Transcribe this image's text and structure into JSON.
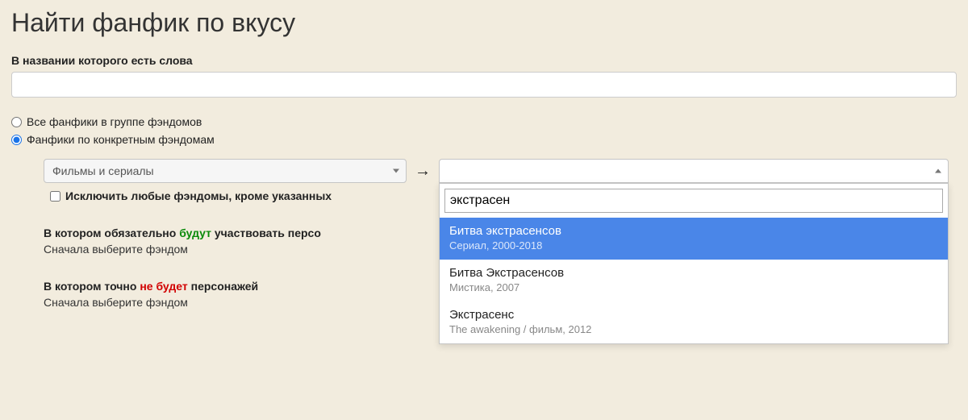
{
  "page_title": "Найти фанфик по вкусу",
  "title_field": {
    "label": "В названии которого есть слова",
    "value": ""
  },
  "scope_radios": {
    "all_label": "Все фанфики в группе фэндомов",
    "specific_label": "Фанфики по конкретным фэндомам",
    "selected": "specific"
  },
  "fandom_group_select": {
    "value": "Фильмы и сериалы"
  },
  "arrow_symbol": "→",
  "fandom_search": {
    "value": "экстрасен",
    "options": [
      {
        "title": "Битва экстрасенсов",
        "sub": "Сериал, 2000-2018",
        "highlighted": true
      },
      {
        "title": "Битва Экстрасенсов",
        "sub": "Мистика, 2007",
        "highlighted": false
      },
      {
        "title": "Экстрасенс",
        "sub": "The awakening / фильм, 2012",
        "highlighted": false
      }
    ]
  },
  "exclude_checkbox": {
    "label": "Исключить любые фэндомы, кроме указанных",
    "checked": false
  },
  "characters_include": {
    "pre": "В котором обязательно ",
    "em": "будут",
    "post": " участвовать персо",
    "hint": "Сначала выберите фэндом"
  },
  "characters_exclude": {
    "pre": "В котором точно ",
    "em": "не будет",
    "post": " персонажей",
    "hint": "Сначала выберите фэндом"
  }
}
